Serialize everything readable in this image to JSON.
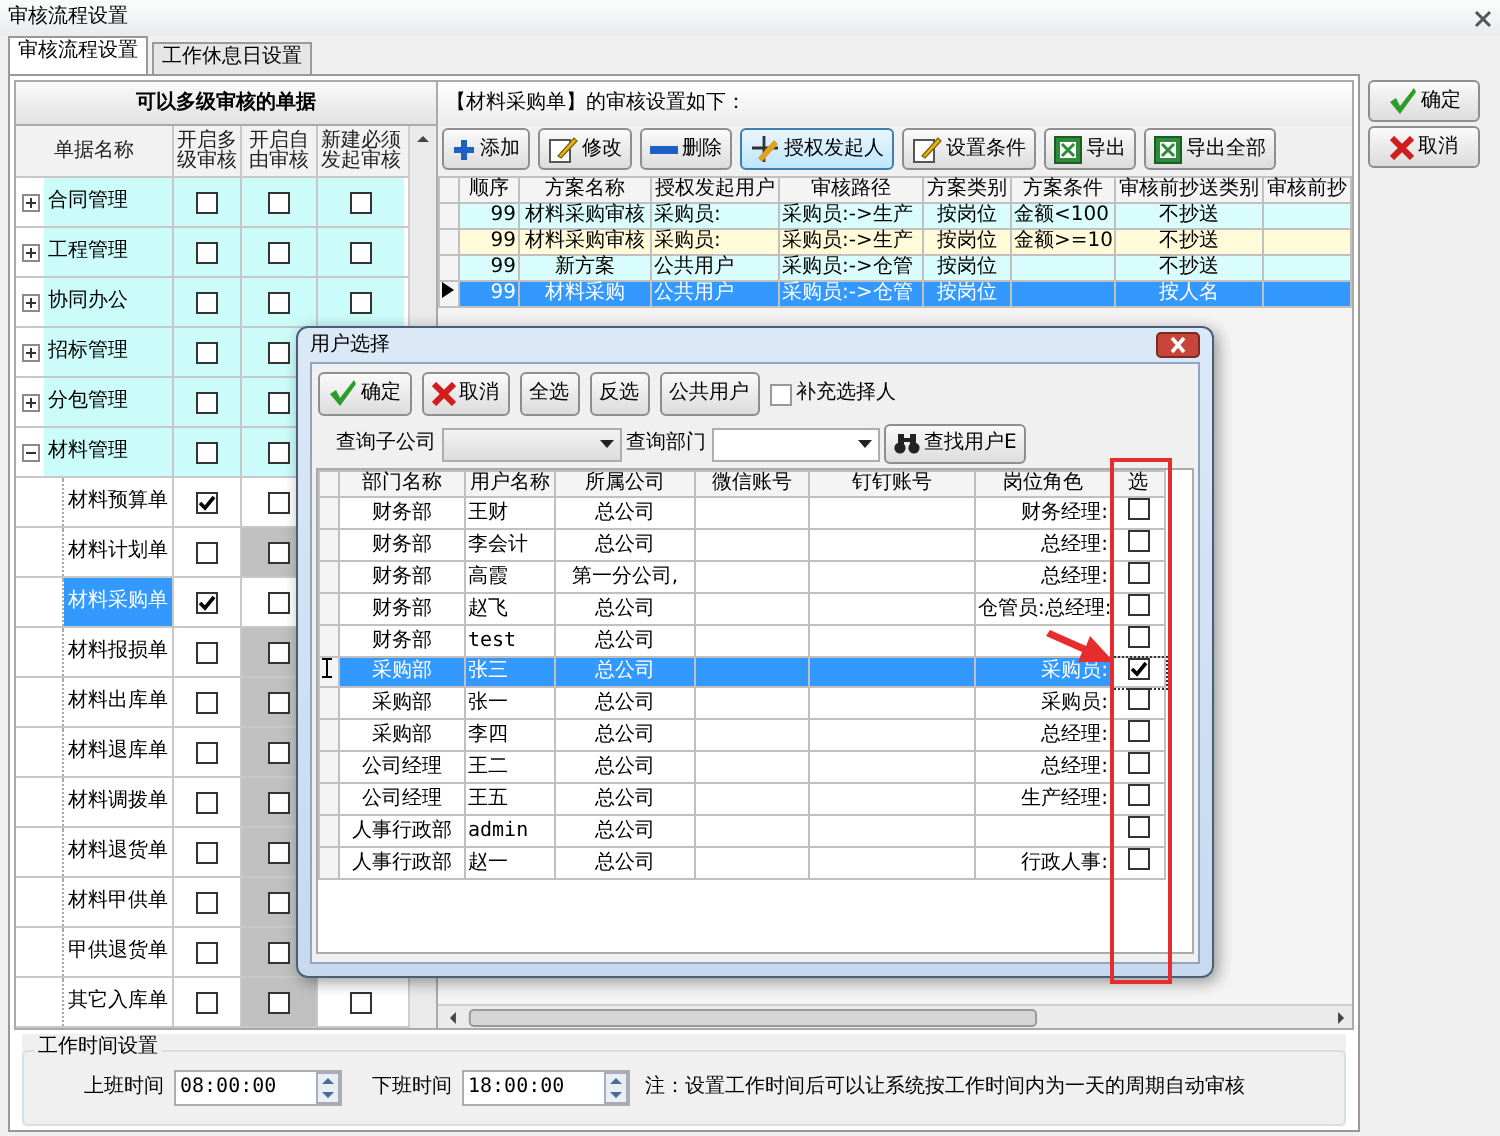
{
  "window": {
    "title": "审核流程设置"
  },
  "tabs": [
    {
      "label": "审核流程设置",
      "selected": true
    },
    {
      "label": "工作休息日设置",
      "selected": false
    }
  ],
  "side_buttons": [
    {
      "label": "确定",
      "kind": "ok"
    },
    {
      "label": "取消",
      "kind": "cancel"
    }
  ],
  "document_grid": {
    "title": "可以多级审核的单据",
    "columns": [
      "单据名称",
      "开启多级审核",
      "开启自由审核",
      "新建必须发起审核"
    ],
    "rows": [
      {
        "name": "合同管理",
        "expanded": false,
        "selected": false,
        "checks": [
          false,
          false,
          false
        ]
      },
      {
        "name": "工程管理",
        "expanded": false,
        "selected": false,
        "checks": [
          false,
          false,
          false
        ]
      },
      {
        "name": "协同办公",
        "expanded": false,
        "selected": false,
        "checks": [
          false,
          false,
          false
        ]
      },
      {
        "name": "招标管理",
        "expanded": false,
        "selected": false,
        "checks": [
          false,
          false
        ]
      },
      {
        "name": "分包管理",
        "expanded": false,
        "selected": false,
        "checks": [
          false,
          false
        ]
      },
      {
        "name": "材料管理",
        "expanded": true,
        "selected": false,
        "checks": [
          false,
          false
        ],
        "children": [
          {
            "name": "材料预算单",
            "selected": false,
            "shaded": false,
            "checks": [
              true,
              false
            ]
          },
          {
            "name": "材料计划单",
            "selected": false,
            "shaded": true,
            "checks": [
              false,
              false
            ]
          },
          {
            "name": "材料采购单",
            "selected": true,
            "shaded": false,
            "checks": [
              true,
              false
            ]
          },
          {
            "name": "材料报损单",
            "selected": false,
            "shaded": true,
            "checks": [
              false,
              false
            ]
          },
          {
            "name": "材料出库单",
            "selected": false,
            "shaded": true,
            "checks": [
              false,
              false
            ]
          },
          {
            "name": "材料退库单",
            "selected": false,
            "shaded": true,
            "checks": [
              false,
              false
            ]
          },
          {
            "name": "材料调拨单",
            "selected": false,
            "shaded": true,
            "checks": [
              false,
              false
            ]
          },
          {
            "name": "材料退货单",
            "selected": false,
            "shaded": true,
            "checks": [
              false,
              false
            ]
          },
          {
            "name": "材料甲供单",
            "selected": false,
            "shaded": true,
            "checks": [
              false,
              false
            ]
          },
          {
            "name": "甲供退货单",
            "selected": false,
            "shaded": true,
            "checks": [
              false,
              false
            ]
          },
          {
            "name": "其它入库单",
            "selected": false,
            "shaded": true,
            "checks": [
              false,
              false,
              false
            ]
          }
        ]
      }
    ]
  },
  "scheme_panel": {
    "caption": "【材料采购单】的审核设置如下：",
    "toolbar": [
      {
        "label": "添加",
        "kind": "add",
        "focused": false
      },
      {
        "label": "修改",
        "kind": "edit",
        "focused": false
      },
      {
        "label": "删除",
        "kind": "remove",
        "focused": false
      },
      {
        "label": "授权发起人",
        "kind": "authorize",
        "focused": true
      },
      {
        "label": "设置条件",
        "kind": "edit",
        "focused": false
      },
      {
        "label": "导出",
        "kind": "export",
        "focused": false
      },
      {
        "label": "导出全部",
        "kind": "export",
        "focused": false
      }
    ],
    "columns": [
      "顺序",
      "方案名称",
      "授权发起用户",
      "审核路径",
      "方案类别",
      "方案条件",
      "审核前抄送类别",
      "审核前抄"
    ],
    "rows": [
      {
        "cells": [
          "99",
          "材料采购审核",
          "采购员:",
          "采购员:->生产",
          "按岗位",
          "金额<100",
          "不抄送"
        ],
        "color": "#d9fdfd",
        "selected": false
      },
      {
        "cells": [
          "99",
          "材料采购审核",
          "采购员:",
          "采购员:->生产",
          "按岗位",
          "金额>=10",
          "不抄送"
        ],
        "color": "#fffbd9",
        "selected": false
      },
      {
        "cells": [
          "99",
          "新方案",
          "公共用户",
          "采购员:->仓管",
          "按岗位",
          "",
          "不抄送"
        ],
        "color": "#d9fdfd",
        "selected": false
      },
      {
        "cells": [
          "99",
          "材料采购",
          "公共用户",
          "采购员:->仓管",
          "按岗位",
          "",
          "按人名"
        ],
        "selected": true
      }
    ]
  },
  "user_dialog": {
    "title": "用户选择",
    "toolbar": [
      {
        "label": "确定",
        "kind": "ok"
      },
      {
        "label": "取消",
        "kind": "cancel"
      },
      {
        "label": "全选",
        "kind": "plain"
      },
      {
        "label": "反选",
        "kind": "plain"
      },
      {
        "label": "公共用户",
        "kind": "plain"
      }
    ],
    "supplement": {
      "label": "补充选择人",
      "checked": false
    },
    "filters": [
      {
        "label": "查询子公司",
        "disabled": true
      },
      {
        "label": "查询部门",
        "disabled": false
      }
    ],
    "search_button": "查找用户E",
    "columns": [
      "部门名称",
      "用户名称",
      "所属公司",
      "微信账号",
      "钉钉账号",
      "岗位角色",
      "选"
    ],
    "rows": [
      {
        "department": "财务部",
        "user": "王财",
        "company": "总公司",
        "role": "财务经理:",
        "selected": false,
        "checked": false
      },
      {
        "department": "财务部",
        "user": "李会计",
        "company": "总公司",
        "role": "总经理:",
        "selected": false,
        "checked": false
      },
      {
        "department": "财务部",
        "user": "高霞",
        "company": "第一分公司,",
        "role": "总经理:",
        "selected": false,
        "checked": false
      },
      {
        "department": "财务部",
        "user": "赵飞",
        "company": "总公司",
        "role": "仓管员:总经理:",
        "selected": false,
        "checked": false
      },
      {
        "department": "财务部",
        "user": "test",
        "company": "总公司",
        "selected": false,
        "checked": false
      },
      {
        "department": "采购部",
        "user": "张三",
        "company": "总公司",
        "role": "采购员:",
        "selected": true,
        "checked": true
      },
      {
        "department": "采购部",
        "user": "张一",
        "company": "总公司",
        "role": "采购员:",
        "selected": false,
        "checked": false
      },
      {
        "department": "采购部",
        "user": "李四",
        "company": "总公司",
        "role": "总经理:",
        "selected": false,
        "checked": false
      },
      {
        "department": "公司经理",
        "user": "王二",
        "company": "总公司",
        "role": "总经理:",
        "selected": false,
        "checked": false
      },
      {
        "department": "公司经理",
        "user": "王五",
        "company": "总公司",
        "role": "生产经理:",
        "selected": false,
        "checked": false
      },
      {
        "department": "人事行政部",
        "user": "admin",
        "company": "总公司",
        "selected": false,
        "checked": false
      },
      {
        "department": "人事行政部",
        "user": "赵一",
        "company": "总公司",
        "role": "行政人事:",
        "selected": false,
        "checked": false
      }
    ]
  },
  "work_time": {
    "title": "工作时间设置",
    "start": {
      "label": "上班时间",
      "value": "08:00:00"
    },
    "end": {
      "label": "下班时间",
      "value": "18:00:00"
    },
    "note": "注：设置工作时间后可以让系统按工作时间内为一天的周期自动审核"
  }
}
